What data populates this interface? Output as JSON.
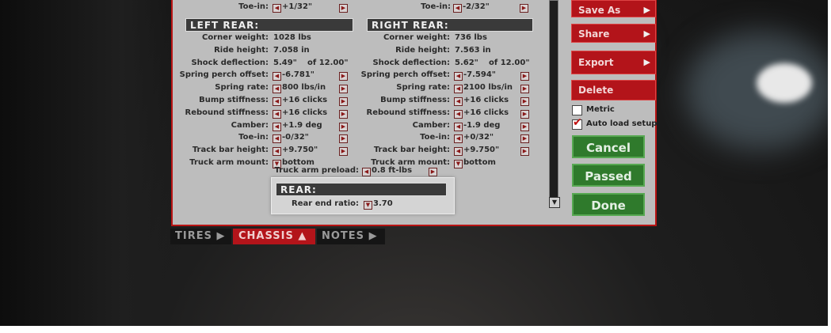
{
  "top_row": {
    "left_label": "Toe-in:",
    "left_value": "+1/32\"",
    "right_label": "Toe-in:",
    "right_value": "-2/32\""
  },
  "left_rear": {
    "title": "LEFT REAR:",
    "rows": [
      {
        "label": "Corner weight:",
        "value": "1028 lbs"
      },
      {
        "label": "Ride height:",
        "value": "7.058 in"
      },
      {
        "label": "Shock deflection:",
        "value": "5.49\"",
        "extra": "of 12.00\""
      },
      {
        "label": "Spring perch offset:",
        "value": "-6.781\""
      },
      {
        "label": "Spring rate:",
        "value": "800 lbs/in"
      },
      {
        "label": "Bump stiffness:",
        "value": "+16 clicks"
      },
      {
        "label": "Rebound stiffness:",
        "value": "+16 clicks"
      },
      {
        "label": "Camber:",
        "value": "+1.9 deg"
      },
      {
        "label": "Toe-in:",
        "value": "-0/32\""
      },
      {
        "label": "Track bar height:",
        "value": "+9.750\""
      },
      {
        "label": "Truck arm mount:",
        "value": "bottom"
      }
    ]
  },
  "right_rear": {
    "title": "RIGHT REAR:",
    "rows": [
      {
        "label": "Corner weight:",
        "value": "736 lbs"
      },
      {
        "label": "Ride height:",
        "value": "7.563 in"
      },
      {
        "label": "Shock deflection:",
        "value": "5.62\"",
        "extra": "of 12.00\""
      },
      {
        "label": "Spring perch offset:",
        "value": "-7.594\""
      },
      {
        "label": "Spring rate:",
        "value": "2100 lbs/in"
      },
      {
        "label": "Bump stiffness:",
        "value": "+16 clicks"
      },
      {
        "label": "Rebound stiffness:",
        "value": "+16 clicks"
      },
      {
        "label": "Camber:",
        "value": "-1.9 deg"
      },
      {
        "label": "Toe-in:",
        "value": "+0/32\""
      },
      {
        "label": "Track bar height:",
        "value": "+9.750\""
      },
      {
        "label": "Truck arm mount:",
        "value": "bottom"
      }
    ]
  },
  "preload": {
    "label": "Truck arm preload:",
    "value": "0.8 ft-lbs"
  },
  "rear": {
    "title": "REAR:",
    "label": "Rear end ratio:",
    "value": "3.70"
  },
  "side_buttons": {
    "save_as": "Save As",
    "share": "Share",
    "export": "Export",
    "delete": "Delete"
  },
  "options": {
    "metric": "Metric",
    "auto_load": "Auto load setup",
    "metric_checked": false,
    "auto_load_checked": true
  },
  "actions": {
    "cancel": "Cancel",
    "passed": "Passed",
    "done": "Done"
  },
  "tabs": [
    {
      "label": "TIRES",
      "glyph": "▶",
      "active": false
    },
    {
      "label": "CHASSIS",
      "glyph": "▲",
      "active": true
    },
    {
      "label": "NOTES",
      "glyph": "▶",
      "active": false
    }
  ],
  "colors": {
    "accent_red": "#b3141a",
    "green": "#2f7a2c",
    "panel": "#bdbdbd"
  }
}
